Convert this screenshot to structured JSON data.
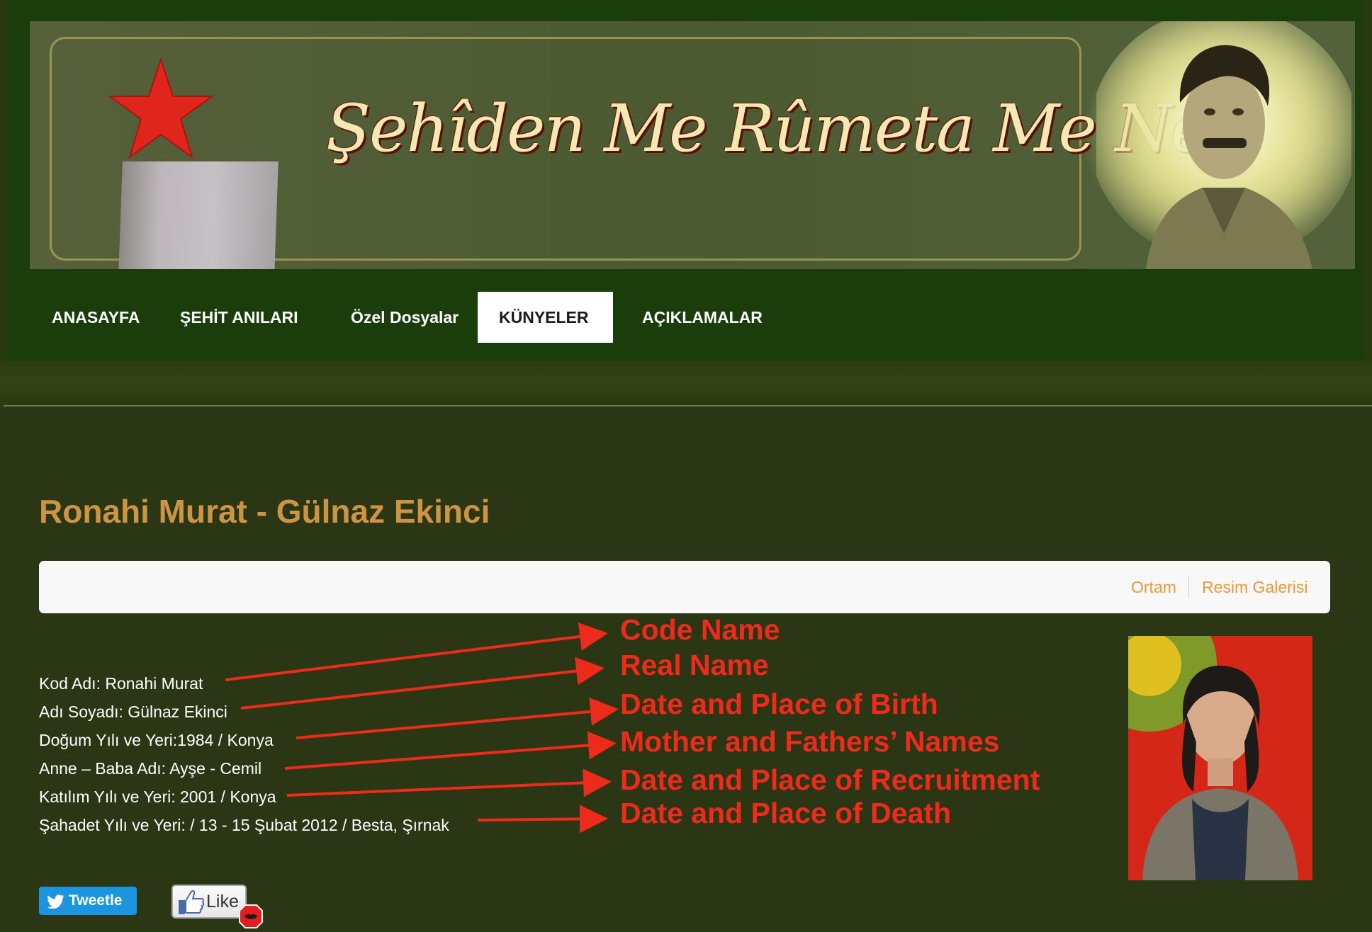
{
  "header": {
    "banner_title": "Şehîden Me Rûmeta Me Ne"
  },
  "nav": {
    "items": [
      {
        "label": "ANASAYFA"
      },
      {
        "label": "ŞEHİT ANILARI"
      },
      {
        "label": "Özel Dosyalar"
      },
      {
        "label": "KÜNYELER"
      },
      {
        "label": "AÇIKLAMALAR"
      }
    ],
    "active": "KÜNYELER"
  },
  "main": {
    "title": "Ronahi Murat - Gülnaz Ekinci",
    "tabs": [
      {
        "label": "Ortam"
      },
      {
        "label": "Resim Galerisi"
      }
    ],
    "details": [
      "Kod Adı: Ronahi Murat",
      "Adı Soyadı: Gülnaz Ekinci",
      "Doğum Yılı ve Yeri:1984 / Konya",
      "Anne – Baba Adı: Ayşe - Cemil",
      "Katılım Yılı ve Yeri: 2001 / Konya",
      "Şahadet Yılı ve Yeri: / 13 - 15 Şubat 2012 / Besta, Şırnak"
    ],
    "annotations": [
      "Code Name",
      "Real Name",
      "Date and Place of Birth",
      "Mother and Fathers’ Names",
      "Date and Place of Recruitment",
      "Date and Place of Death"
    ]
  },
  "social": {
    "tweet_label": "Tweetle",
    "like_label": "Like"
  },
  "colors": {
    "page_bg": "#2b3714",
    "header_bg": "#1b3d0c",
    "title": "#cc9443",
    "tab_link": "#e89a38",
    "annotation": "#ee2a1b",
    "tweet": "#1b95e0",
    "photo_bg": "#d42718"
  }
}
